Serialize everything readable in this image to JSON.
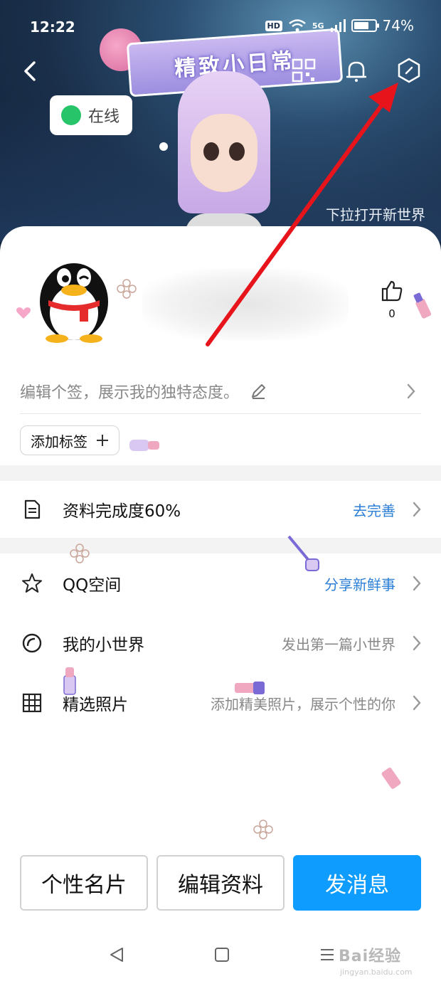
{
  "status_bar": {
    "time": "12:22",
    "hd": "HD",
    "network": "5G",
    "battery": "74%",
    "battery_level": 0.74
  },
  "cover": {
    "banner_text": "精致小日常",
    "online_status": "在线",
    "pull_hint": "下拉打开新世界"
  },
  "profile": {
    "likes": "0",
    "signature_placeholder": "编辑个签，展示我的独特态度。",
    "add_tag_label": "添加标签"
  },
  "list": {
    "completion": {
      "label": "资料完成度60%",
      "action": "去完善"
    },
    "qzone": {
      "label": "QQ空间",
      "action": "分享新鲜事"
    },
    "world": {
      "label": "我的小世界",
      "action": "发出第一篇小世界"
    },
    "photos": {
      "label": "精选照片",
      "action": "添加精美照片，展示个性的你"
    }
  },
  "buttons": {
    "card": "个性名片",
    "edit": "编辑资料",
    "message": "发消息"
  },
  "watermark": {
    "main": "Bai经验",
    "sub": "jingyan.baidu.com"
  },
  "colors": {
    "accent_blue": "#0f9cff",
    "link_blue": "#2b7fd6",
    "online_green": "#27c46a",
    "annotation_red": "#e8141c"
  }
}
